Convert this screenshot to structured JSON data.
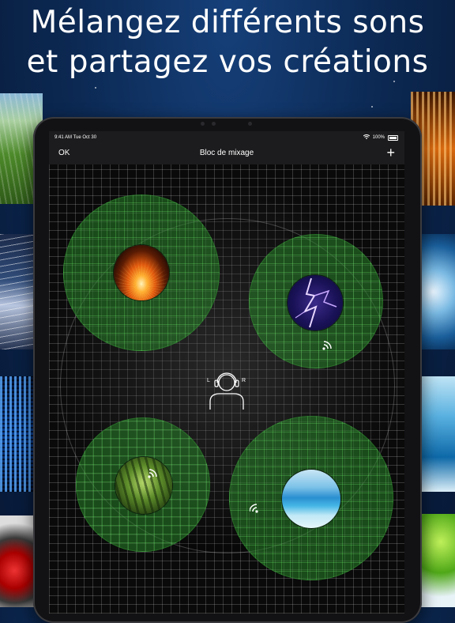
{
  "headline": {
    "line1": "Mélangez différents sons",
    "line2": "et partagez vos créations"
  },
  "status_bar": {
    "time": "9:41 AM  Tue Oct 30",
    "battery": "100%"
  },
  "nav": {
    "left_button": "OK",
    "title": "Bloc de mixage",
    "right_button": "+"
  },
  "listener": {
    "icon": "headphones-listener-icon",
    "left_label": "L",
    "right_label": "R"
  },
  "sounds": [
    {
      "name": "fire",
      "icon": "fire-image"
    },
    {
      "name": "thunderstorm",
      "icon": "lightning-image"
    },
    {
      "name": "forest",
      "icon": "forest-image"
    },
    {
      "name": "ocean",
      "icon": "ocean-image"
    }
  ],
  "colors": {
    "zone_green": "#2a8a2a",
    "nav_bg": "#1c1c1e",
    "page_bg": "#0c2a55"
  }
}
